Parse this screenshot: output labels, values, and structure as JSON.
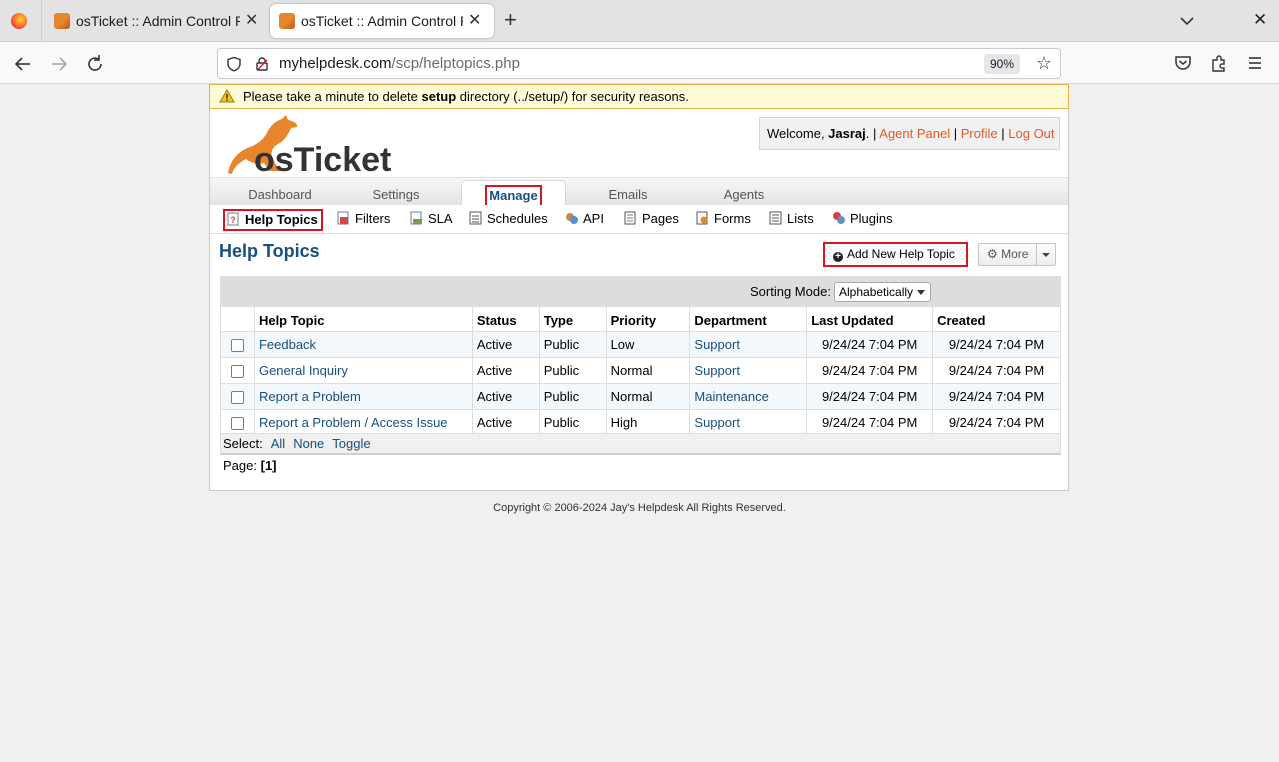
{
  "browser": {
    "tabs": [
      {
        "title": "osTicket :: Admin Control Panel",
        "active": false
      },
      {
        "title": "osTicket :: Admin Control Panel",
        "active": true
      }
    ],
    "url_host": "myhelpdesk.com",
    "url_path": "/scp/helptopics.php",
    "zoom": "90%"
  },
  "warning": {
    "prefix": "Please take a minute to delete ",
    "bold": "setup",
    "suffix": " directory (../setup/) for security reasons."
  },
  "header": {
    "welcome_prefix": "Welcome, ",
    "user": "Jasraj",
    "welcome_suffix": ". |",
    "agent_panel": "Agent Panel",
    "sep1": "|",
    "profile": "Profile",
    "sep2": "|",
    "logout": "Log Out"
  },
  "main_nav": {
    "dashboard": "Dashboard",
    "settings": "Settings",
    "manage": "Manage",
    "emails": "Emails",
    "agents": "Agents"
  },
  "sub_nav": {
    "help_topics": "Help Topics",
    "filters": "Filters",
    "sla": "SLA",
    "schedules": "Schedules",
    "api": "API",
    "pages": "Pages",
    "forms": "Forms",
    "lists": "Lists",
    "plugins": "Plugins"
  },
  "page": {
    "title": "Help Topics",
    "add_button": "Add New Help Topic",
    "more_button": "More",
    "sorting_label": "Sorting Mode:",
    "sorting_value": "Alphabetically"
  },
  "table": {
    "headers": {
      "topic": "Help Topic",
      "status": "Status",
      "type": "Type",
      "priority": "Priority",
      "department": "Department",
      "updated": "Last Updated",
      "created": "Created"
    },
    "rows": [
      {
        "topic": "Feedback",
        "status": "Active",
        "type": "Public",
        "priority": "Low",
        "department": "Support",
        "updated": "9/24/24 7:04 PM",
        "created": "9/24/24 7:04 PM"
      },
      {
        "topic": "General Inquiry",
        "status": "Active",
        "type": "Public",
        "priority": "Normal",
        "department": "Support",
        "updated": "9/24/24 7:04 PM",
        "created": "9/24/24 7:04 PM"
      },
      {
        "topic": "Report a Problem",
        "status": "Active",
        "type": "Public",
        "priority": "Normal",
        "department": "Maintenance",
        "updated": "9/24/24 7:04 PM",
        "created": "9/24/24 7:04 PM"
      },
      {
        "topic": "Report a Problem / Access Issue",
        "status": "Active",
        "type": "Public",
        "priority": "High",
        "department": "Support",
        "updated": "9/24/24 7:04 PM",
        "created": "9/24/24 7:04 PM"
      }
    ],
    "select_label": "Select:",
    "select_all": "All",
    "select_none": "None",
    "select_toggle": "Toggle",
    "page_label": "Page:",
    "page_current": "[1]"
  },
  "footer": {
    "copyright": "Copyright © 2006-2024 Jay's Helpdesk All Rights Reserved."
  },
  "colors": {
    "brand_orange": "#e6852b",
    "title_blue": "#184e81",
    "highlight_red": "#d7141f",
    "warning_bg": "#fefcd7"
  },
  "icons": {
    "back": "arrow-left",
    "forward": "arrow-right",
    "reload": "reload",
    "bookmark": "star",
    "pocket": "pocket",
    "extensions": "puzzle",
    "menu": "hamburger",
    "warning": "warning-triangle",
    "add": "plus-circle",
    "more": "gear"
  }
}
